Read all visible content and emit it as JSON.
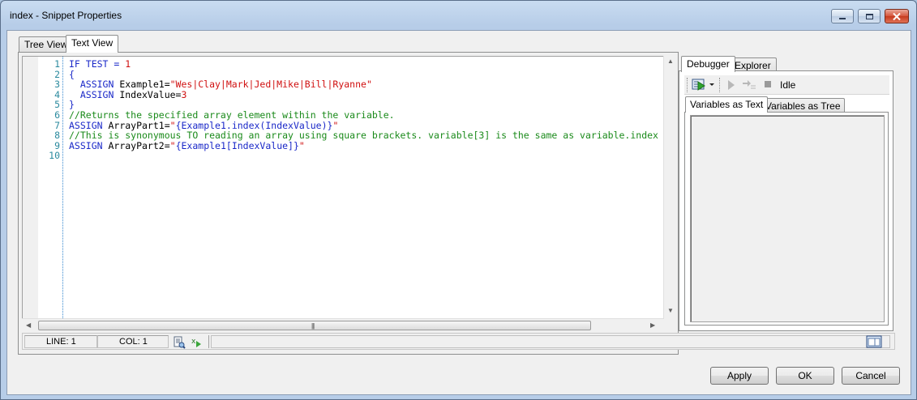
{
  "window": {
    "title": "index - Snippet Properties"
  },
  "tabs": [
    {
      "label": "Tree View",
      "active": false
    },
    {
      "label": "Text View",
      "active": true
    }
  ],
  "editor": {
    "line_numbers": [
      "1",
      "2",
      "3",
      "4",
      "5",
      "6",
      "7",
      "8",
      "9",
      "10"
    ],
    "lines": [
      [
        {
          "t": "kw",
          "v": "IF TEST = "
        },
        {
          "t": "num",
          "v": "1"
        }
      ],
      [
        {
          "t": "kw",
          "v": "{"
        }
      ],
      [
        {
          "t": "kw",
          "v": "  ASSIGN "
        },
        {
          "t": "plain",
          "v": "Example1="
        },
        {
          "t": "str",
          "v": "\"Wes|Clay|Mark|Jed|Mike|Bill|Ryanne\""
        }
      ],
      [
        {
          "t": "kw",
          "v": "  ASSIGN "
        },
        {
          "t": "plain",
          "v": "IndexValue="
        },
        {
          "t": "num",
          "v": "3"
        }
      ],
      [
        {
          "t": "kw",
          "v": "}"
        }
      ],
      [
        {
          "t": "cmt",
          "v": "//Returns the specified array element within the variable."
        }
      ],
      [
        {
          "t": "kw",
          "v": "ASSIGN "
        },
        {
          "t": "plain",
          "v": "ArrayPart1="
        },
        {
          "t": "str",
          "v": "\""
        },
        {
          "t": "kw",
          "v": "{Example1.index(IndexValue)}"
        },
        {
          "t": "str",
          "v": "\""
        }
      ],
      [
        {
          "t": "cmt",
          "v": "//This is synonymous TO reading an array using square brackets. variable[3] is the same as variable.index"
        }
      ],
      [
        {
          "t": "kw",
          "v": "ASSIGN "
        },
        {
          "t": "plain",
          "v": "ArrayPart2="
        },
        {
          "t": "str",
          "v": "\""
        },
        {
          "t": "kw",
          "v": "{Example1[IndexValue]}"
        },
        {
          "t": "str",
          "v": "\""
        }
      ],
      []
    ]
  },
  "status": {
    "line": "LINE: 1",
    "col": "COL: 1"
  },
  "right_panel": {
    "tabs": [
      {
        "label": "Debugger",
        "active": true
      },
      {
        "label": "Explorer",
        "active": false
      }
    ],
    "debug_state": "Idle",
    "sub_tabs": [
      {
        "label": "Variables as Text",
        "active": true
      },
      {
        "label": "Variables as Tree",
        "active": false
      }
    ]
  },
  "buttons": {
    "apply": "Apply",
    "ok": "OK",
    "cancel": "Cancel"
  },
  "colors": {
    "keyword": "#1a28c8",
    "string": "#d01010",
    "comment": "#1a8a1a",
    "line_number": "#2b8a9e"
  }
}
